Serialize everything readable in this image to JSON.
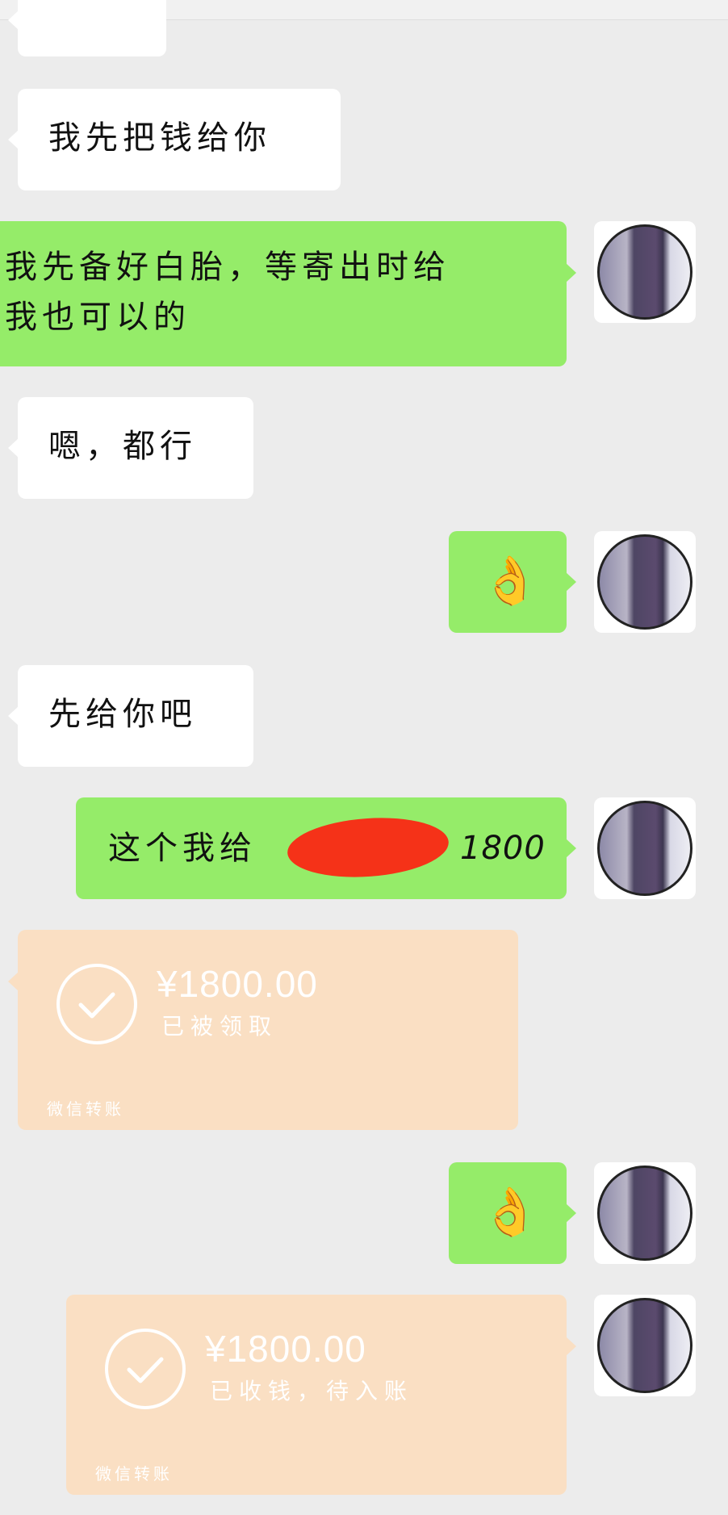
{
  "messages": {
    "m1": {
      "text": "我先把钱给你"
    },
    "m2": {
      "text": "我先备好白胎，等寄出时给\n我也可以的"
    },
    "m3": {
      "text": "嗯，都行"
    },
    "m4": {
      "emoji": "👌"
    },
    "m5": {
      "text": "先给你吧"
    },
    "m6": {
      "text_prefix": "这个我给",
      "text_suffix": "1800"
    },
    "m7": {
      "amount": "¥1800.00",
      "status": "已被领取",
      "footer": "微信转账"
    },
    "m8": {
      "emoji": "👌"
    },
    "m9": {
      "amount": "¥1800.00",
      "status": "已收钱，待入账",
      "footer": "微信转账"
    }
  },
  "colors": {
    "background": "#ececec",
    "incoming_bubble": "#ffffff",
    "outgoing_bubble": "#95ec69",
    "transfer_card": "#fadfc3",
    "redaction": "#f53218"
  },
  "icons": {
    "ok_hand": "ok-hand-emoji",
    "check": "check-circle-icon",
    "avatar": "user-avatar"
  }
}
